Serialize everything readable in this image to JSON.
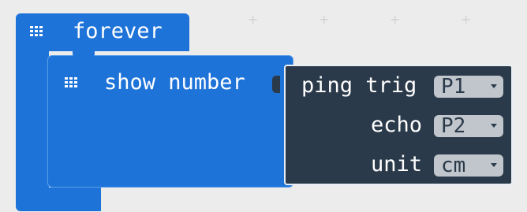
{
  "forever": {
    "label": "forever",
    "icon": "grid-icon"
  },
  "show_number": {
    "label": "show number",
    "icon": "grid-icon"
  },
  "ping": {
    "label": "ping trig",
    "trig_value": "P1",
    "echo_label": "echo",
    "echo_value": "P2",
    "unit_label": "unit",
    "unit_value": "cm"
  },
  "colors": {
    "basic_block": "#1e73d8",
    "sonar_block": "#2b3a4a",
    "dropdown": "#c0c6cc",
    "workspace": "#ececec"
  }
}
